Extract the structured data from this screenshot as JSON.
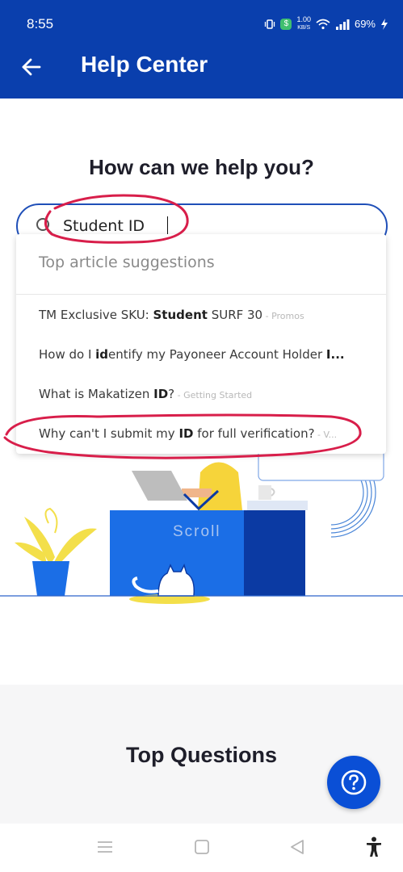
{
  "status_bar": {
    "time": "8:55",
    "net_speed_value": "1.00",
    "net_speed_unit": "KB/S",
    "battery": "69%",
    "icons": [
      "vibrate-icon",
      "shield-dollar-icon",
      "wifi-icon",
      "signal-icon",
      "battery-bolt-icon"
    ]
  },
  "app_bar": {
    "title": "Help Center",
    "back_icon": "arrow-left-icon"
  },
  "main": {
    "heading": "How can we help you?",
    "search": {
      "value": "Student ID",
      "icon": "search-icon"
    },
    "suggestions": {
      "header": "Top article suggestions",
      "items": [
        {
          "pre": "TM Exclusive SKU: ",
          "match": "Student",
          "post": " SURF 30",
          "category": " - Promos"
        },
        {
          "pre": "How do I ",
          "match": "id",
          "post": "entify my Payoneer Account Holder ",
          "match2": "I...",
          "category": ""
        },
        {
          "pre": "What is Makatizen ",
          "match": "ID",
          "post": "?",
          "category": " - Getting Started"
        },
        {
          "pre": "Why can't I submit my ",
          "match": "ID",
          "post": " for full verification?",
          "category": " - V..."
        }
      ]
    },
    "illustration": {
      "scroll_label": "Scroll"
    }
  },
  "bottom": {
    "section_title": "Top Questions",
    "help_button_icon": "question-circle-icon"
  },
  "nav_bar": {
    "icons": [
      "menu-icon",
      "home-square-icon",
      "back-triangle-icon",
      "accessibility-icon"
    ]
  },
  "colors": {
    "brand": "#0a3fad",
    "fab": "#0a4fd6",
    "annotation": "#d81e4a"
  }
}
